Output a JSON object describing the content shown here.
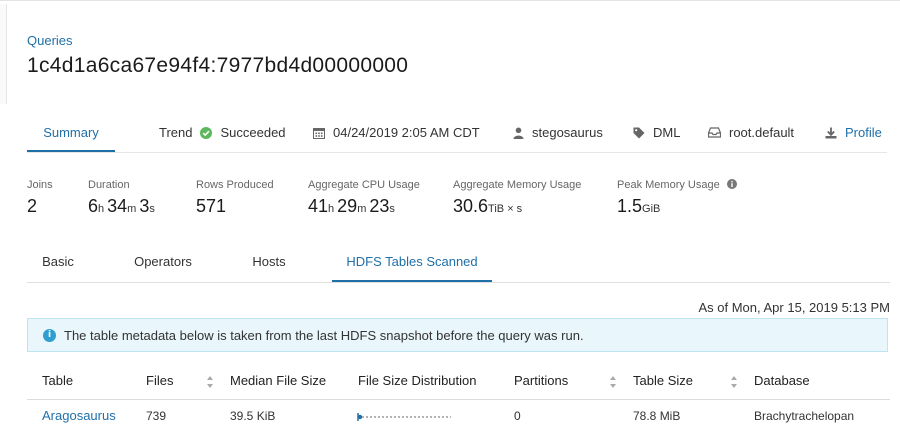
{
  "header": {
    "breadcrumb": "Queries",
    "query_id": "1c4d1a6ca67e94f4:7977bd4d00000000"
  },
  "summary_tab": "Summary",
  "meta": {
    "trend_label": "Trend",
    "status": "Succeeded",
    "status_color": "#5cb85c",
    "date": "04/24/2019 2:05 AM CDT",
    "user": "stegosaurus",
    "type": "DML",
    "pool": "root.default",
    "profile_label": "Profile",
    "icons": [
      "check-circle-icon",
      "calendar-icon",
      "user-icon",
      "tag-icon",
      "inbox-icon",
      "download-icon"
    ]
  },
  "stats": {
    "joins": {
      "label": "Joins",
      "value": "2"
    },
    "duration": {
      "label": "Duration",
      "h": "6",
      "h_unit": "h",
      "m": "34",
      "m_unit": "m",
      "s": "3",
      "s_unit": "s"
    },
    "rows_produced": {
      "label": "Rows Produced",
      "value": "571"
    },
    "cpu": {
      "label": "Aggregate CPU Usage",
      "h": "41",
      "h_unit": "h",
      "m": "29",
      "m_unit": "m",
      "s": "23",
      "s_unit": "s"
    },
    "memory": {
      "label": "Aggregate Memory Usage",
      "value": "30.6",
      "unit": "TiB × s"
    },
    "peak": {
      "label": "Peak Memory Usage",
      "value": "1.5",
      "unit": "GiB"
    }
  },
  "tabs": {
    "basic": "Basic",
    "operators": "Operators",
    "hosts": "Hosts",
    "hdfs": "HDFS Tables Scanned"
  },
  "as_of": "As of Mon, Apr 15, 2019 5:13 PM",
  "alert_text": "The table metadata below is taken from the last HDFS snapshot before the query was run.",
  "table": {
    "headers": {
      "table": "Table",
      "files": "Files",
      "median": "Median File Size",
      "distribution": "File Size Distribution",
      "partitions": "Partitions",
      "size": "Table Size",
      "database": "Database"
    },
    "rows": [
      {
        "table": "Aragosaurus",
        "files": "739",
        "median": "39.5 KiB",
        "partitions": "0",
        "size": "78.8 MiB",
        "database": "Brachytrachelopan"
      }
    ]
  },
  "colors": {
    "accent": "#1f6fa8",
    "alert_bg": "#e9f6fb",
    "alert_border": "#bfe4f2",
    "info": "#2e9fd0"
  }
}
